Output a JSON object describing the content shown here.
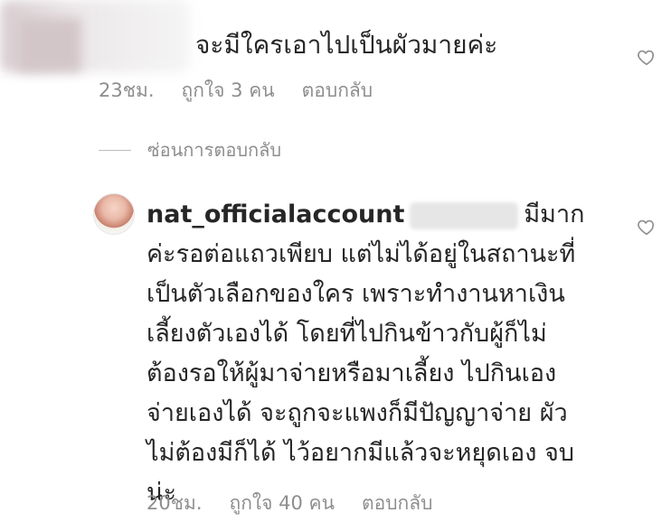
{
  "comment1": {
    "text": "จะมีใครเอาไปเป็นผัวมายค่ะ",
    "time": "23ชม.",
    "likes": "ถูกใจ 3 คน",
    "reply": "ตอบกลับ"
  },
  "hide_replies": "ซ่อนการตอบกลับ",
  "reply": {
    "username": "nat_officialaccount",
    "lines": [
      "มีมาก",
      "ค่ะรอต่อแถวเพียบ แต่ไม่ได้อยู่ในสถานะที่",
      "เป็นตัวเลือกของใคร เพราะทำงานหาเงิน",
      "เลี้ยงตัวเองได้ โดยที่ไปกินข้าวกับผู้ก็ไม่",
      "ต้องรอให้ผู้มาจ่ายหรือมาเลี้ยง ไปกินเอง",
      "จ่ายเองได้ จะถูกจะแพงก็มีปัญญาจ่าย ผัว",
      "ไม่ต้องมีก็ได้ ไว้อยากมีแล้วจะหยุดเอง จบ",
      "น่ะ"
    ],
    "time": "20ชม.",
    "likes": "ถูกใจ 40 คน",
    "reply": "ตอบกลับ"
  },
  "icons": {
    "like": "heart-outline-icon"
  }
}
